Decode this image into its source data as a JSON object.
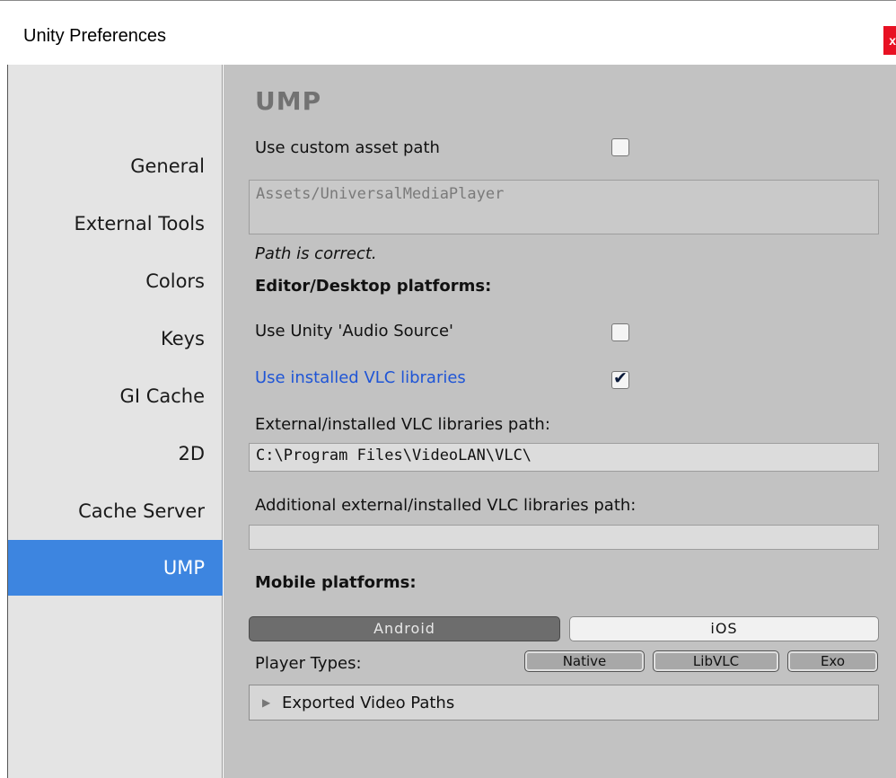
{
  "window": {
    "title": "Unity Preferences",
    "close_label": "x"
  },
  "sidebar": {
    "items": [
      {
        "label": "General",
        "active": false
      },
      {
        "label": "External Tools",
        "active": false
      },
      {
        "label": "Colors",
        "active": false
      },
      {
        "label": "Keys",
        "active": false
      },
      {
        "label": "GI Cache",
        "active": false
      },
      {
        "label": "2D",
        "active": false
      },
      {
        "label": "Cache Server",
        "active": false
      },
      {
        "label": "UMP",
        "active": true
      }
    ]
  },
  "ump": {
    "heading": "UMP",
    "custom_asset_path": {
      "label": "Use custom asset path",
      "checked": false
    },
    "asset_path_value": "Assets/UniversalMediaPlayer",
    "path_status": "Path is correct.",
    "editor_section": "Editor/Desktop platforms:",
    "use_audio_source": {
      "label": "Use Unity 'Audio Source'",
      "checked": false
    },
    "use_installed_vlc": {
      "label": "Use installed VLC libraries",
      "checked": true
    },
    "vlc_path_label": "External/installed VLC libraries path:",
    "vlc_path_value": "C:\\Program Files\\VideoLAN\\VLC\\",
    "additional_path_label": "Additional external/installed VLC libraries path:",
    "additional_path_value": "",
    "mobile_section": "Mobile platforms:",
    "platform_tabs": [
      {
        "label": "Android",
        "active": true
      },
      {
        "label": "iOS",
        "active": false
      }
    ],
    "player_types_label": "Player Types:",
    "player_types": [
      "Native",
      "LibVLC",
      "Exo"
    ],
    "exported_paths_label": "Exported Video Paths"
  },
  "colors": {
    "accent": "#3d85e0",
    "link": "#1f55d6",
    "close": "#e81123"
  }
}
